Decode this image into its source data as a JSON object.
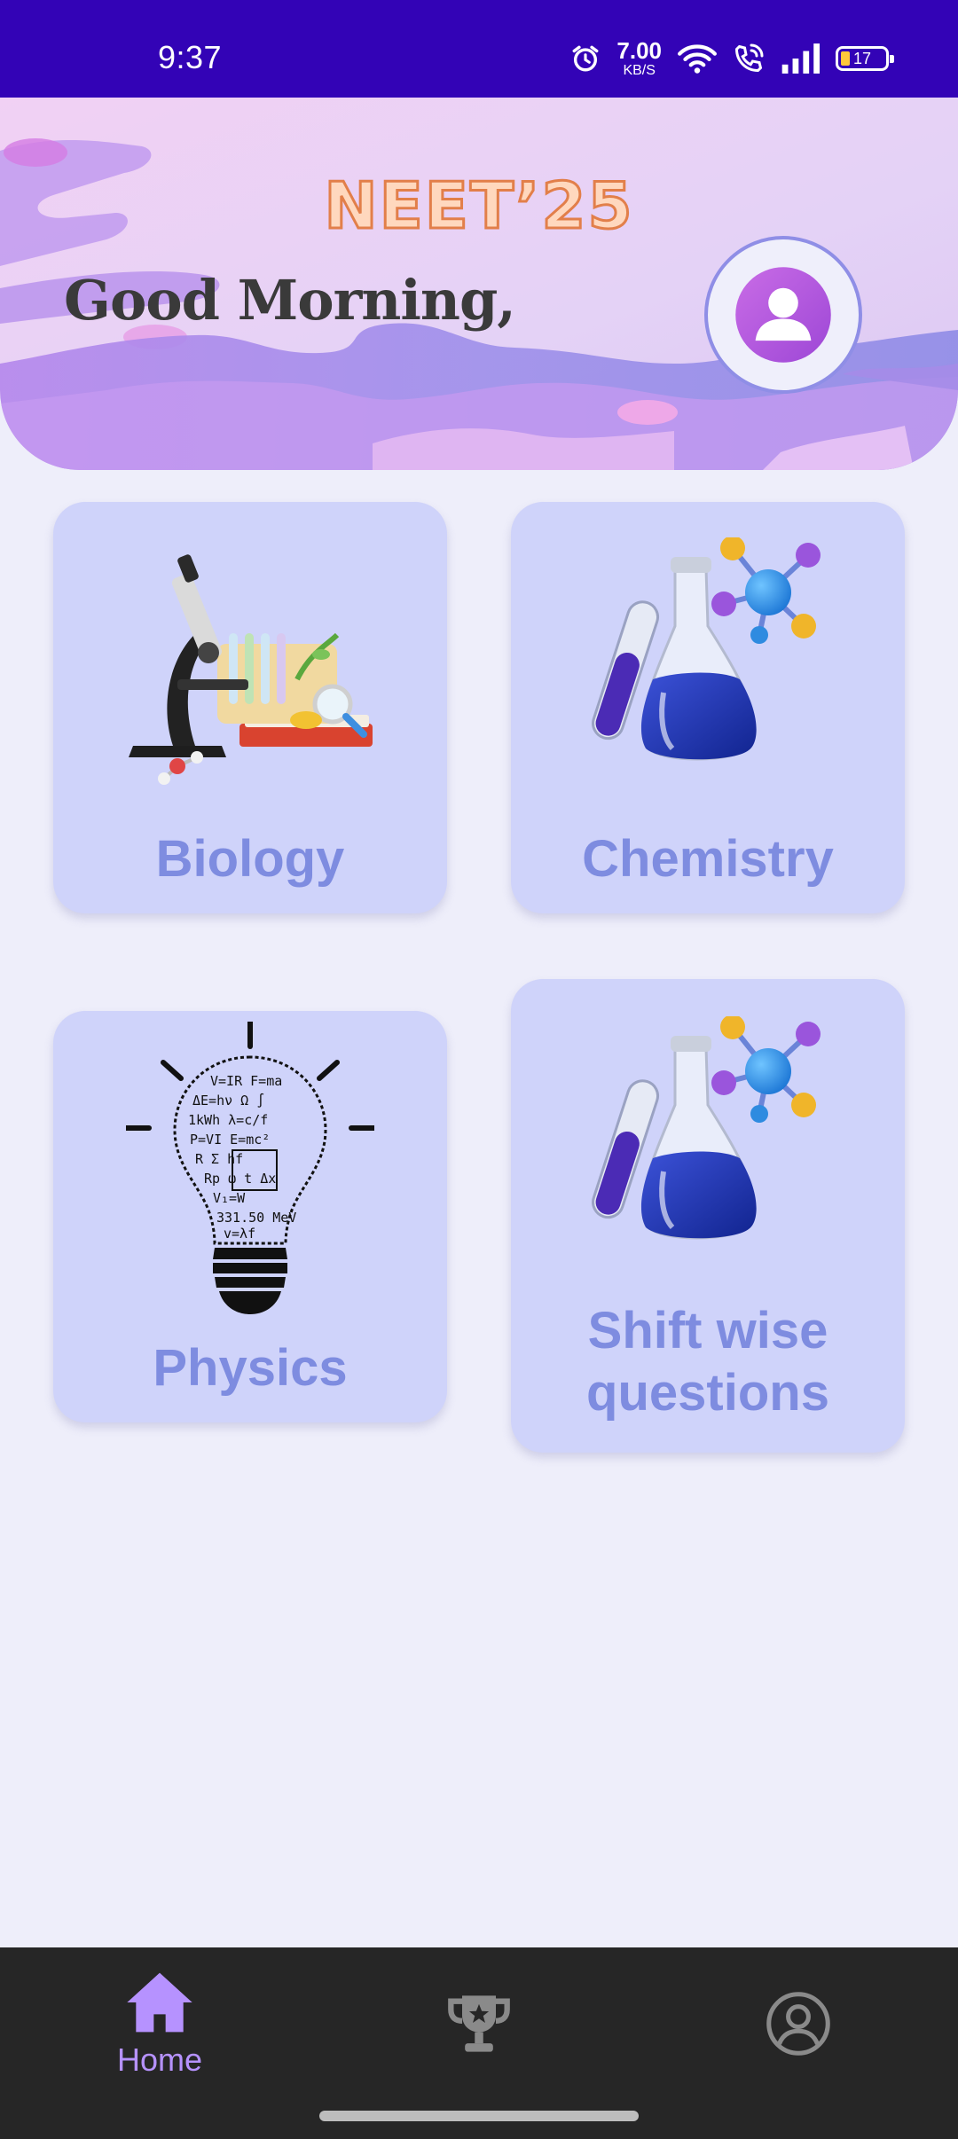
{
  "status_bar": {
    "time": "9:37",
    "net_speed_value": "7.00",
    "net_speed_unit": "KB/S",
    "battery_level": "17"
  },
  "header": {
    "brand": "NEET’25",
    "greeting": "Good Morning,"
  },
  "subjects": [
    {
      "label": "Biology",
      "icon": "microscope-lab-illustration"
    },
    {
      "label": "Chemistry",
      "icon": "flask-molecule-illustration"
    },
    {
      "label": "Physics",
      "icon": "formula-lightbulb-illustration"
    },
    {
      "label": "Shift wise questions",
      "icon": "flask-molecule-illustration"
    }
  ],
  "bottom_nav": {
    "items": [
      {
        "label": "Home",
        "icon": "home-icon",
        "active": true
      },
      {
        "label": "",
        "icon": "trophy-icon",
        "active": false
      },
      {
        "label": "",
        "icon": "account-icon",
        "active": false
      }
    ]
  },
  "colors": {
    "status_bar": "#3303B6",
    "card_bg": "#CFD3FA",
    "card_text": "#7E8CE0",
    "nav_active": "#B692FF",
    "nav_bg": "#262626"
  }
}
